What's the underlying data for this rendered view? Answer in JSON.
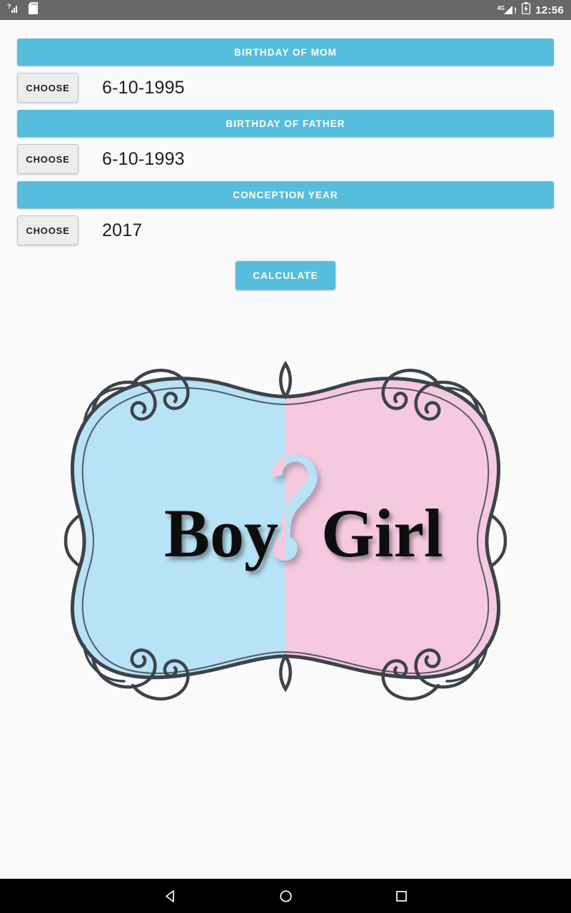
{
  "statusbar": {
    "left_icons": [
      "signal-unknown-icon",
      "sd-card-icon"
    ],
    "network_label": "4G",
    "alert_label": "!",
    "right_icons": [
      "signal-4g-icon",
      "battery-icon"
    ],
    "clock": "12:56"
  },
  "form": {
    "sections": [
      {
        "header": "BIRTHDAY OF MOM",
        "button_label": "CHOOSE",
        "value": "6-10-1995"
      },
      {
        "header": "BIRTHDAY OF FATHER",
        "button_label": "CHOOSE",
        "value": "6-10-1993"
      },
      {
        "header": "CONCEPTION YEAR",
        "button_label": "CHOOSE",
        "value": "2017"
      }
    ],
    "calculate_label": "CALCULATE"
  },
  "hero": {
    "left_word": "Boy",
    "question_mark": "?",
    "right_word": "Girl",
    "blue": "#b8e2f5",
    "pink": "#f5c9e0",
    "frame_stroke": "#3d434a",
    "word_color": "#080808"
  },
  "navbar": {
    "back_label": "back-icon",
    "home_label": "home-icon",
    "recents_label": "recents-icon"
  },
  "theme": {
    "accent": "#56bedc",
    "background": "#fafafa",
    "statusbar_bg": "#686868",
    "navbar_bg": "#000000",
    "button_bg": "#eceded"
  }
}
